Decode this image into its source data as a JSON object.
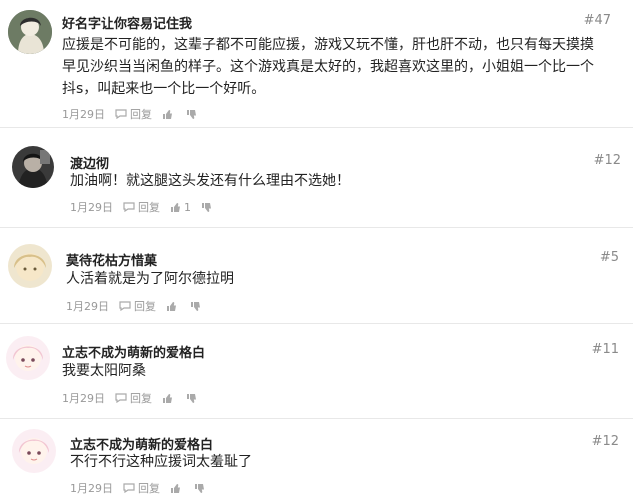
{
  "comments": [
    {
      "name": "好名字让你容易记住我",
      "floor": "#47",
      "lines": [
        "应援是不可能的，这辈子都不可能应援，游戏又玩不懂，肝也肝不动，也只有每天摸摸",
        "早见沙织当当闲鱼的样子。这个游戏真是太好的，我超喜欢这里的，小姐姐一个比一个",
        "抖s，叫起来也一个比一个好听。"
      ],
      "date": "1月29日",
      "reply_label": "回复",
      "likes": ""
    },
    {
      "name": "渡边彻",
      "floor": "#12",
      "lines": [
        "加油啊！就这腿这头发还有什么理由不选她！"
      ],
      "date": "1月29日",
      "reply_label": "回复",
      "likes": "1"
    },
    {
      "name": "莫待花枯方惜菓",
      "floor": "#5",
      "lines": [
        "人活着就是为了阿尔德拉明"
      ],
      "date": "1月29日",
      "reply_label": "回复",
      "likes": ""
    },
    {
      "name": "立志不成为萌新的爱格白",
      "floor": "#11",
      "lines": [
        "我要太阳阿桑"
      ],
      "date": "1月29日",
      "reply_label": "回复",
      "likes": ""
    },
    {
      "name": "立志不成为萌新的爱格白",
      "floor": "#12",
      "lines": [
        "不行不行这种应援词太羞耻了"
      ],
      "date": "1月29日",
      "reply_label": "回复",
      "likes": ""
    }
  ],
  "colors": {
    "divider": "#e8e8e8",
    "meta": "#999999",
    "floor": "#8a8a8a"
  }
}
